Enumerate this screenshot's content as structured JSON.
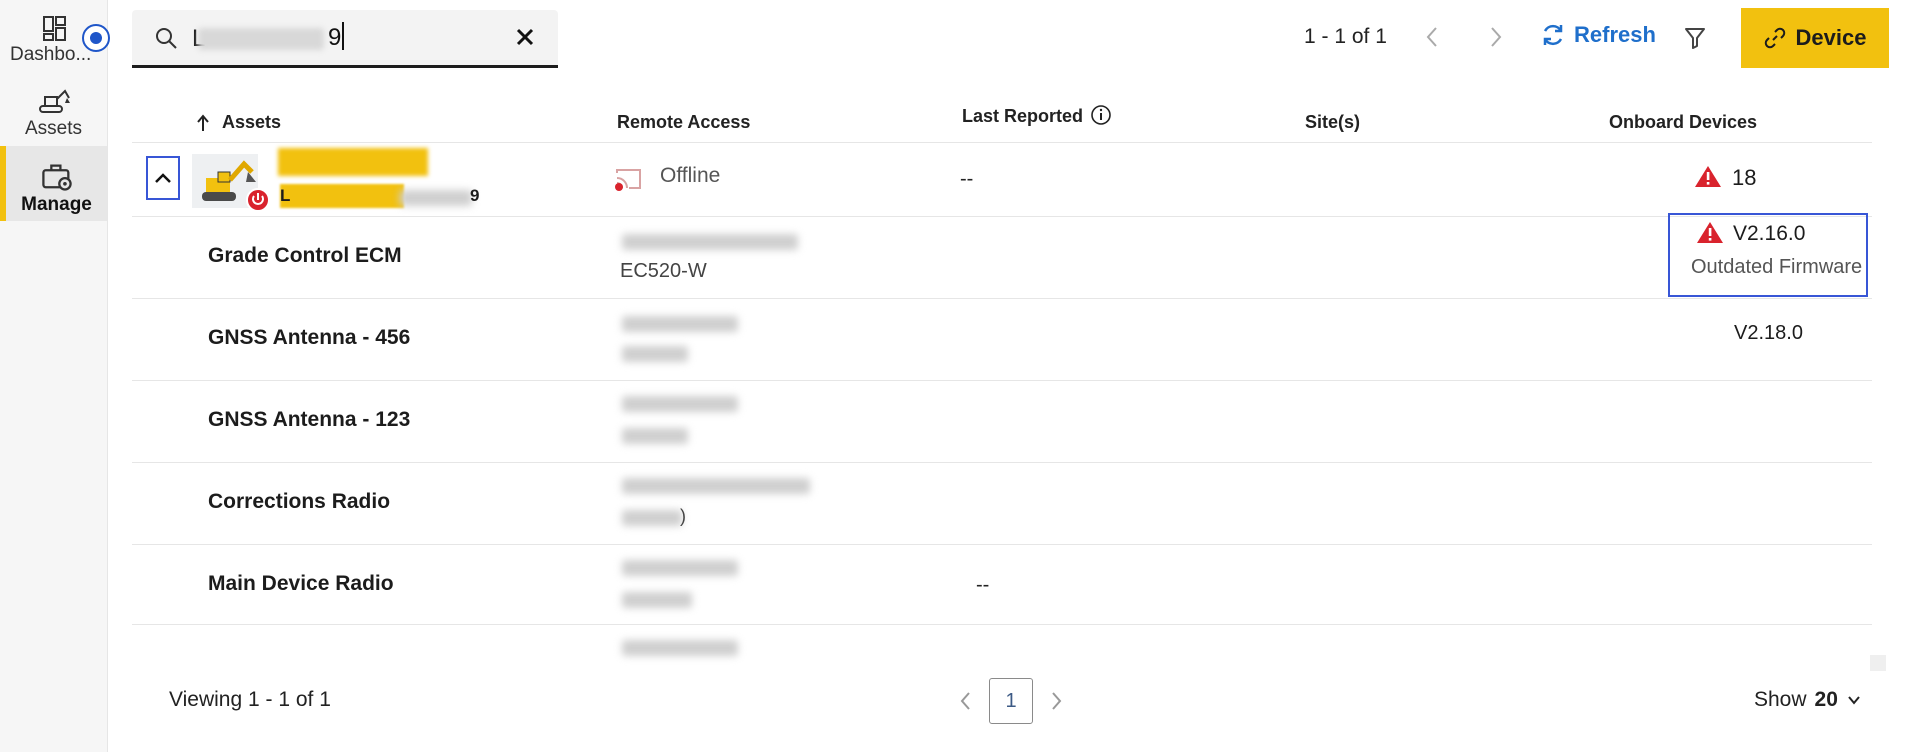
{
  "sidebar": {
    "items": [
      {
        "label": "Dashbo...",
        "icon": "dashboard-icon"
      },
      {
        "label": "Assets",
        "icon": "excavator-icon"
      },
      {
        "label": "Manage",
        "icon": "toolbox-gear-icon",
        "active": true
      }
    ]
  },
  "search": {
    "value": "L",
    "trailing_char": "9",
    "placeholder": ""
  },
  "toolbar": {
    "range": "1 - 1 of 1",
    "refresh_label": "Refresh",
    "device_button_label": "Device"
  },
  "table": {
    "columns": [
      "Assets",
      "Remote Access",
      "Last Reported",
      "Site(s)",
      "Onboard Devices"
    ],
    "asset": {
      "name_prefix": "L",
      "name_suffix": "9",
      "remote_access": "Offline",
      "last_reported": "--",
      "onboard_devices": "18"
    },
    "devices": [
      {
        "name": "Grade Control ECM",
        "model": "EC520-W",
        "firmware": "V2.16.0",
        "firmware_status": "Outdated Firmware"
      },
      {
        "name": "GNSS Antenna - 456",
        "firmware": "V2.18.0"
      },
      {
        "name": "GNSS Antenna - 123"
      },
      {
        "name": "Corrections Radio",
        "model_tail": ")"
      },
      {
        "name": "Main Device Radio",
        "last_reported": "--"
      }
    ]
  },
  "footer": {
    "viewing": "Viewing 1 - 1 of 1",
    "page": "1",
    "show_label": "Show",
    "show_value": "20"
  },
  "colors": {
    "accent_yellow": "#f2c10f",
    "link_blue": "#1f6fcb",
    "focus_blue": "#3856d6",
    "warning_red": "#d9232d"
  }
}
